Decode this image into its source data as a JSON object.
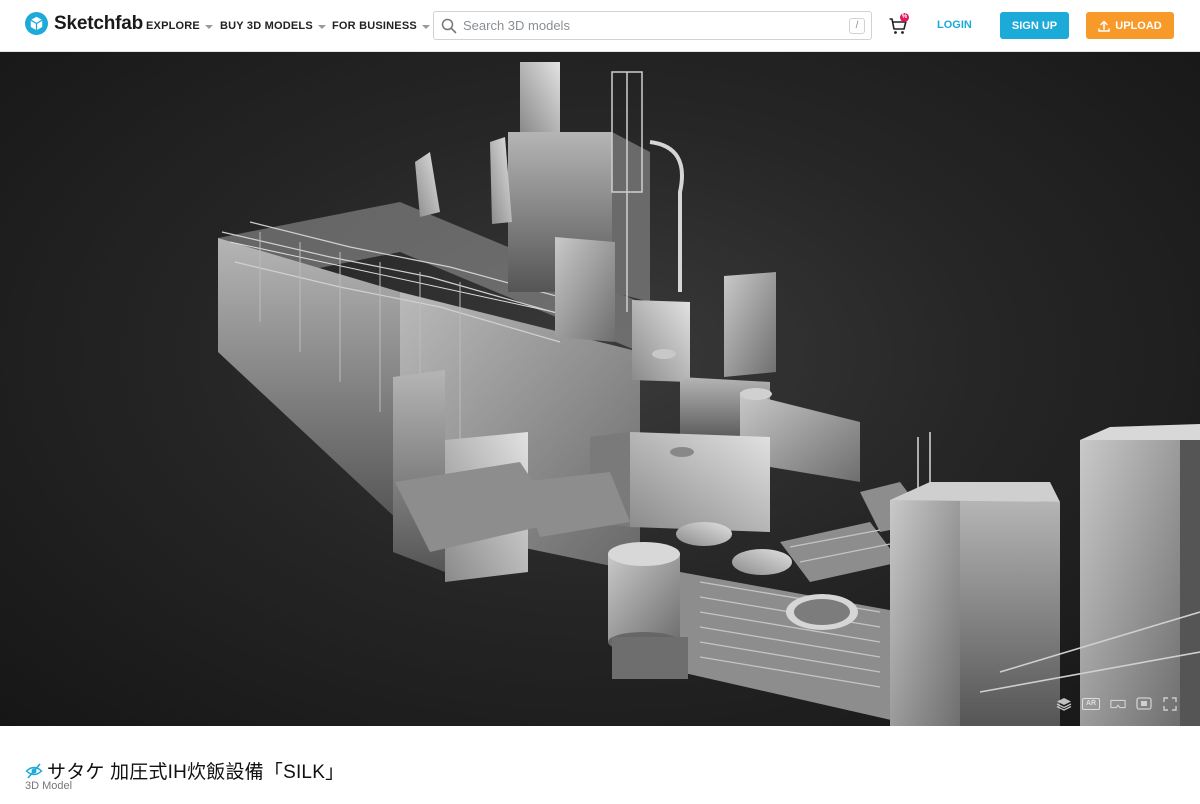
{
  "header": {
    "logo_text": "Sketchfab",
    "nav": [
      {
        "label": "EXPLORE"
      },
      {
        "label": "BUY 3D MODELS"
      },
      {
        "label": "FOR BUSINESS"
      }
    ],
    "search": {
      "placeholder": "Search 3D models",
      "shortcut": "/"
    },
    "cart_badge": "%",
    "login_label": "LOGIN",
    "signup_label": "SIGN UP",
    "upload_label": "UPLOAD"
  },
  "viewer": {
    "controls": [
      "layers-icon",
      "ar-icon",
      "vr-icon",
      "inspector-icon",
      "fullscreen-icon"
    ],
    "ar_label": "AR"
  },
  "model": {
    "title": "サタケ 加圧式IH炊飯設備「SILK」",
    "subtitle": "3D Model"
  },
  "colors": {
    "brand": "#1caad9",
    "upload": "#f89a2a",
    "badge": "#e0195b",
    "viewer_bg": "#262626"
  }
}
